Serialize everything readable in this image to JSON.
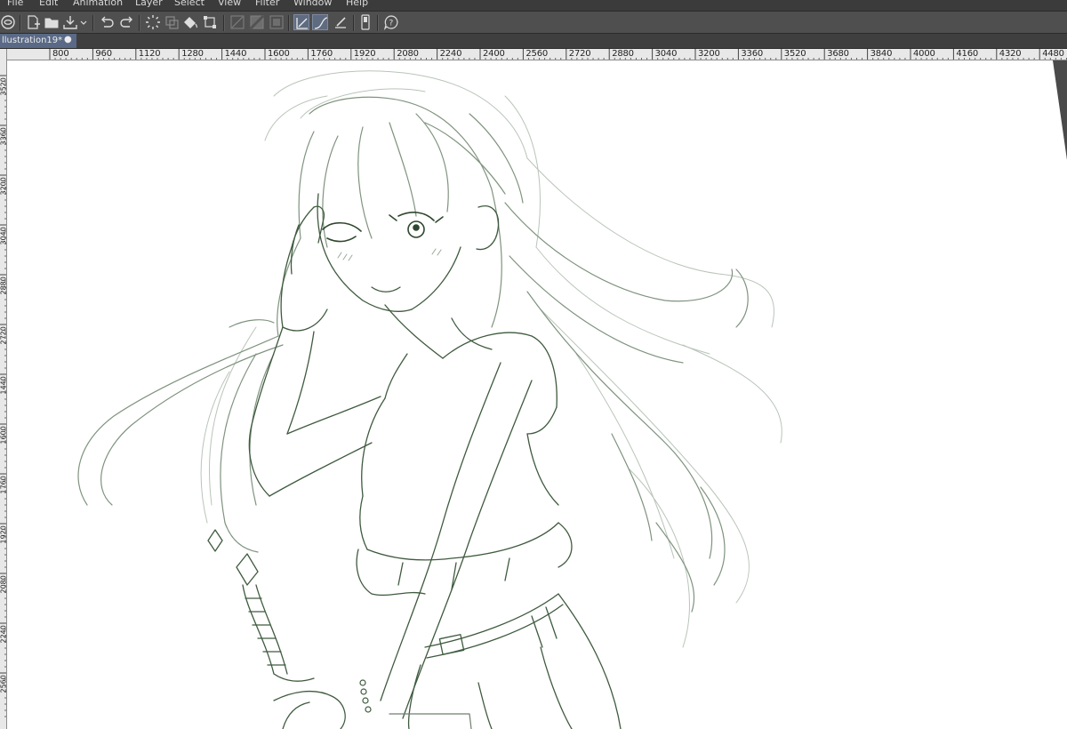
{
  "menu": {
    "items": [
      "File",
      "Edit",
      "Animation",
      "Layer",
      "Select",
      "View",
      "Filter",
      "Window",
      "Help"
    ]
  },
  "toolbar": {
    "buttons": [
      {
        "name": "app-logo-icon"
      },
      {
        "name": "new-file-icon"
      },
      {
        "name": "open-folder-icon"
      },
      {
        "name": "save-icon"
      },
      {
        "name": "undo-icon"
      },
      {
        "name": "redo-icon"
      },
      {
        "name": "loading-spinner-icon"
      },
      {
        "name": "copy-selection-icon"
      },
      {
        "name": "fill-bucket-icon"
      },
      {
        "name": "transform-icon"
      },
      {
        "name": "snap-ruler-icon"
      },
      {
        "name": "snap-grid-icon"
      },
      {
        "name": "snap-special-ruler-icon"
      },
      {
        "name": "stabilization-pen-icon"
      },
      {
        "name": "stroke-curve-icon"
      },
      {
        "name": "pen-pressure-icon"
      },
      {
        "name": "tablet-device-icon"
      },
      {
        "name": "help-icon"
      }
    ]
  },
  "tab": {
    "title": "llustration19*",
    "modified_marker": "●"
  },
  "ruler": {
    "h_labels": [
      "800",
      "960",
      "1120",
      "1280",
      "1440",
      "1600",
      "1760",
      "1920",
      "2080",
      "2240",
      "2400",
      "2560",
      "2720",
      "2880",
      "3040",
      "3200",
      "3360",
      "3520",
      "3680",
      "3840",
      "4000",
      "4160",
      "4320",
      "4480"
    ],
    "v_labels": [
      "3520",
      "3360",
      "3200",
      "3040",
      "2880",
      "2720",
      "1440",
      "1600",
      "1760",
      "1920",
      "2080",
      "2240",
      "2560"
    ]
  },
  "colors": {
    "line_art": "#3f5a3f",
    "line_art_light": "#9aa89a",
    "canvas": "#ffffff",
    "tab_active": "#5a6a86"
  }
}
